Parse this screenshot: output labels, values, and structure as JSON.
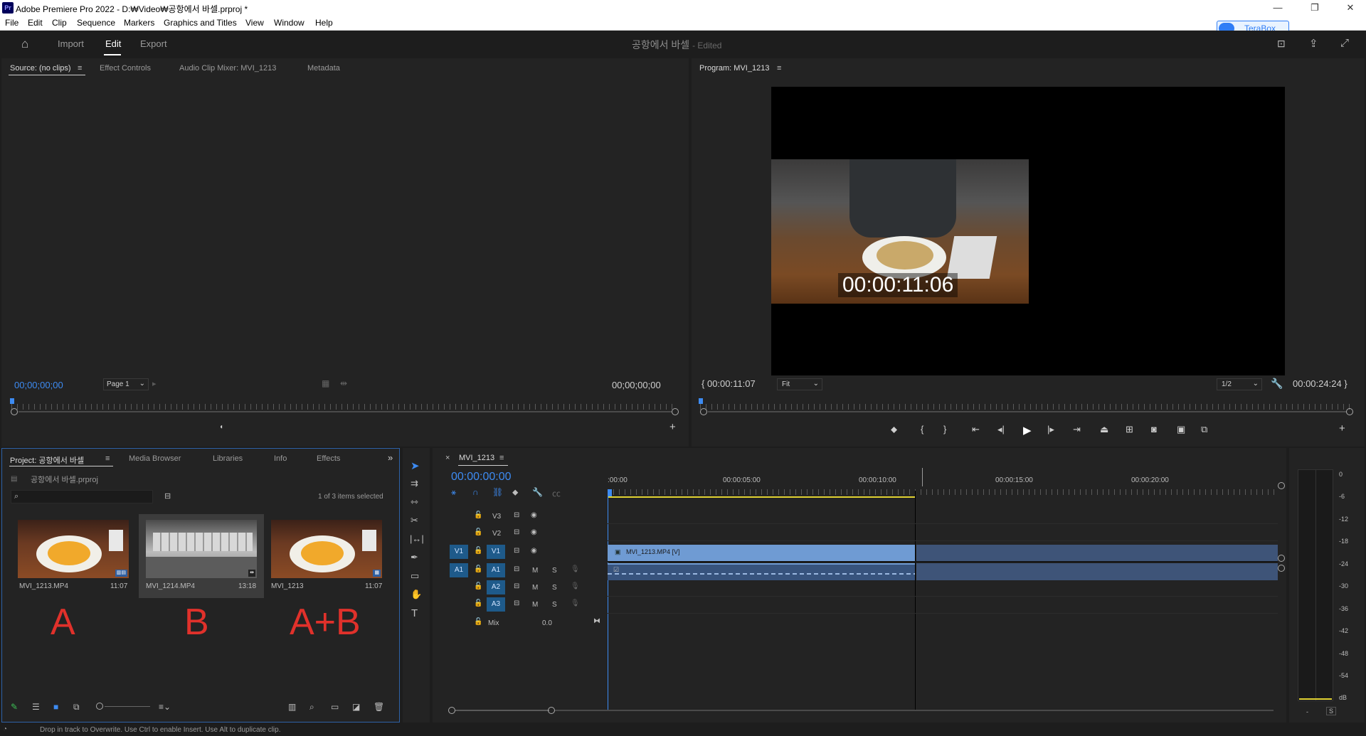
{
  "titlebar": {
    "title": "Adobe Premiere Pro 2022 - D:₩Video₩공항에서 바셀.prproj *",
    "minimize": "—",
    "restore": "❐",
    "close": "✕"
  },
  "menu": [
    "File",
    "Edit",
    "Clip",
    "Sequence",
    "Markers",
    "Graphics and Titles",
    "View",
    "Window",
    "Help"
  ],
  "terabox": {
    "label": "TeraBox"
  },
  "header": {
    "import": "Import",
    "edit": "Edit",
    "export": "Export",
    "doc_title": "공항에서 바셀",
    "doc_status": "- Edited"
  },
  "source_panel": {
    "tabs": [
      "Source: (no clips)",
      "Effect Controls",
      "Audio Clip Mixer: MVI_1213",
      "Metadata"
    ],
    "timecode_left": "00;00;00;00",
    "page": "Page 1",
    "timecode_right": "00;00;00;00"
  },
  "program_panel": {
    "tab": "Program: MVI_1213",
    "overlay_timecode": "00:00:11:06",
    "timecode_left": "00:00:11:07",
    "fit": "Fit",
    "resolution": "1/2",
    "timecode_right": "00:00:24:24"
  },
  "project_panel": {
    "tabs": [
      "Project: 공항에서 바셀",
      "Media Browser",
      "Libraries",
      "Info",
      "Effects"
    ],
    "project_file": "공항에서 바셀.prproj",
    "search_placeholder": "",
    "selection": "1 of 3 items selected",
    "items": [
      {
        "name": "MVI_1213.MP4",
        "duration": "11:07",
        "annotation": "A"
      },
      {
        "name": "MVI_1214.MP4",
        "duration": "13:18",
        "annotation": "B"
      },
      {
        "name": "MVI_1213",
        "duration": "11:07",
        "annotation": "A+B"
      }
    ]
  },
  "timeline": {
    "tab": "MVI_1213",
    "timecode": "00:00:00:00",
    "ruler": [
      ":00:00",
      "00:00:05:00",
      "00:00:10:00",
      "00:00:15:00",
      "00:00:20:00"
    ],
    "tracks": {
      "v3": "V3",
      "v2": "V2",
      "v1": "V1",
      "a1": "A1",
      "a2": "A2",
      "a3": "A3",
      "src_v1": "V1",
      "src_a1": "A1",
      "m": "M",
      "s": "S",
      "mix": "Mix",
      "mix_value": "0.0"
    },
    "clip_v1_label": "MVI_1213.MP4 [V]"
  },
  "audio_meter": {
    "scale": [
      "0",
      "-6",
      "-12",
      "-18",
      "-24",
      "-30",
      "-36",
      "-42",
      "-48",
      "-54",
      "dB"
    ],
    "solo_left": "-",
    "solo_right": "S"
  },
  "status": {
    "text": "Drop in track to Overwrite. Use Ctrl to enable Insert. Use Alt to duplicate clip."
  }
}
